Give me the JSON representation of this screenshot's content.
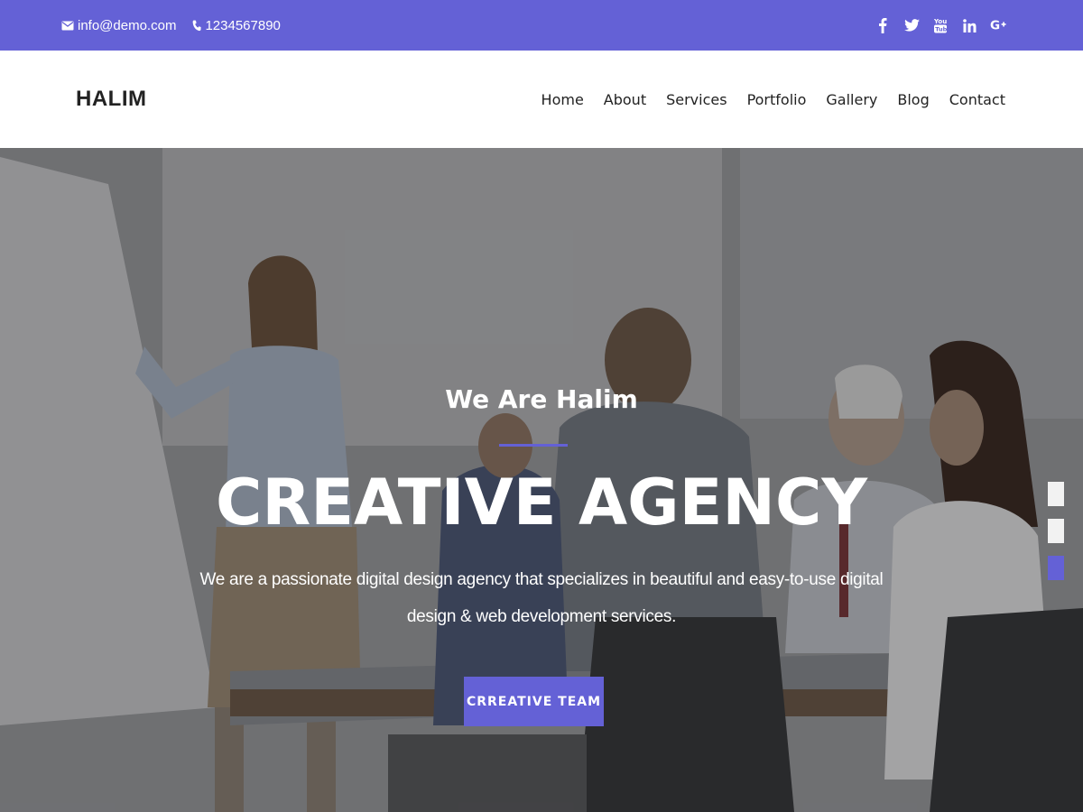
{
  "topbar": {
    "email": "info@demo.com",
    "phone": "1234567890",
    "social": [
      {
        "icon": "facebook-icon",
        "glyph": "f"
      },
      {
        "icon": "twitter-icon",
        "glyph": ""
      },
      {
        "icon": "youtube-icon",
        "glyph": ""
      },
      {
        "icon": "linkedin-icon",
        "glyph": "in"
      },
      {
        "icon": "google-plus-icon",
        "glyph": "G+"
      }
    ]
  },
  "nav": {
    "brand": "HALIM",
    "items": [
      "Home",
      "About",
      "Services",
      "Portfolio",
      "Gallery",
      "Blog",
      "Contact"
    ]
  },
  "hero": {
    "subtitle": "We Are Halim",
    "title": "CREATIVE AGENCY",
    "description": "We are a passionate digital design agency that specializes in beautiful and easy-to-use digital design & web development services.",
    "button": "CRREATIVE TEAM",
    "slides": 3,
    "active_slide": 3
  },
  "colors": {
    "accent": "#6461d6",
    "topbar_bg": "#6461d6",
    "nav_bg": "#ffffff",
    "text_dark": "#222222"
  }
}
